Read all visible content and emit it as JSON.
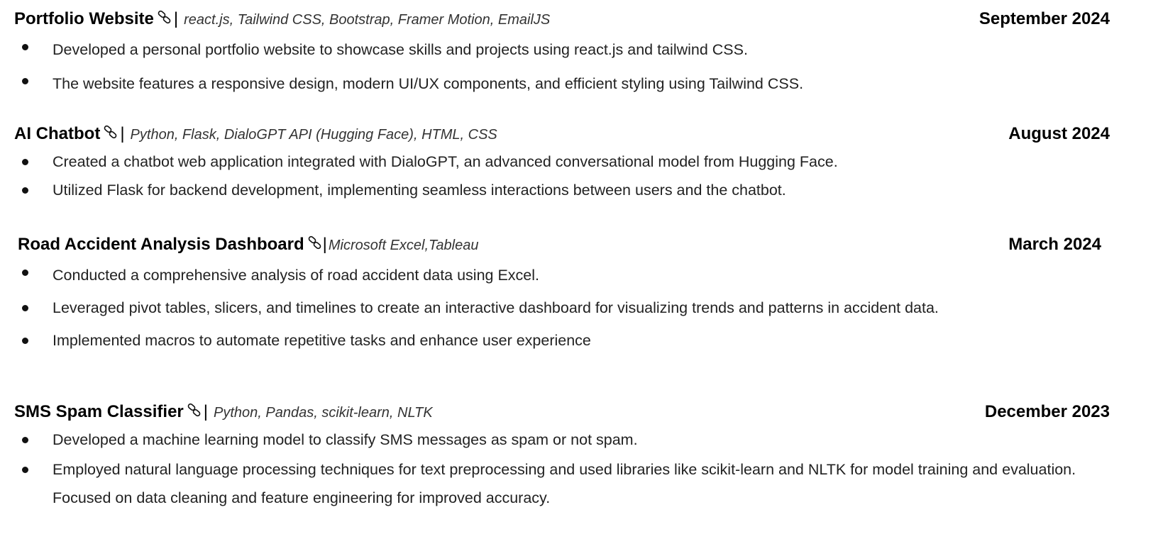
{
  "projects": [
    {
      "title": "Portfolio Website",
      "separator": "|",
      "tech": "react.js, Tailwind CSS, Bootstrap, Framer Motion, EmailJS",
      "date": "September 2024",
      "bullets": [
        "Developed a personal portfolio website to showcase skills and projects using react.js and tailwind CSS.",
        "The website features a responsive design, modern UI/UX components, and efficient styling using Tailwind CSS."
      ]
    },
    {
      "title": "AI Chatbot",
      "separator": "|",
      "tech": "Python, Flask, DialoGPT API (Hugging Face), HTML, CSS",
      "date": "August 2024",
      "bullets": [
        "Created a chatbot web application integrated with DialoGPT, an advanced conversational model from Hugging Face.",
        "Utilized Flask for backend development, implementing seamless interactions between users and the chatbot."
      ]
    },
    {
      "title": "Road Accident Analysis Dashboard",
      "separator": "|",
      "tech": "Microsoft Excel,Tableau",
      "date": "March 2024",
      "bullets": [
        "Conducted a comprehensive analysis of road accident data using Excel.",
        "Leveraged pivot tables, slicers, and timelines to create an interactive dashboard for visualizing trends and patterns in accident data.",
        "Implemented macros to automate repetitive tasks and enhance user experience"
      ]
    },
    {
      "title": "SMS Spam Classifier",
      "separator": "|",
      "tech": "Python, Pandas, scikit-learn, NLTK",
      "date": "December 2023",
      "bullets": [
        "Developed a machine learning model to classify SMS messages as spam or not spam.",
        "Employed natural language processing techniques for text preprocessing and used libraries like scikit-learn and NLTK for model training and evaluation. Focused on data cleaning and feature engineering for improved accuracy."
      ]
    }
  ],
  "icons": {
    "link": "link-icon"
  },
  "colors": {
    "text": "#000000",
    "body_text": "#222222",
    "tech_text": "#333333"
  }
}
